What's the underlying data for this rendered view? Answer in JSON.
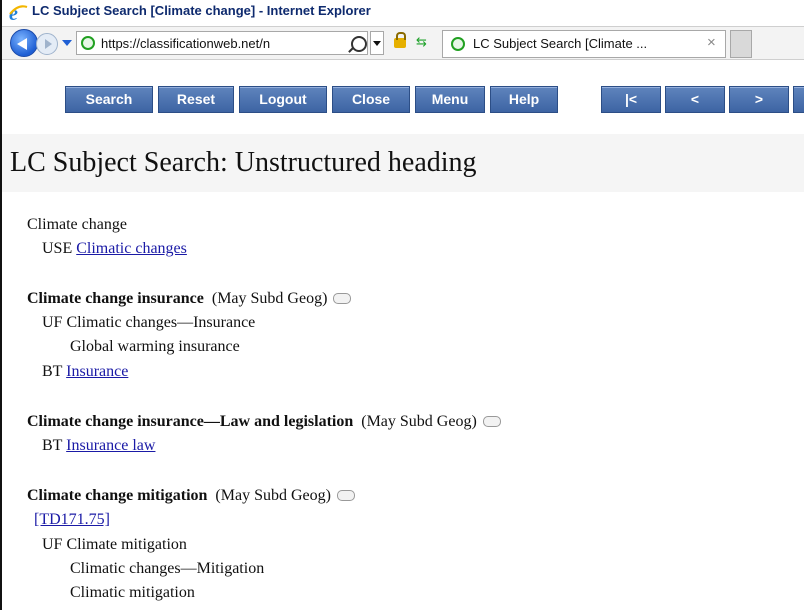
{
  "window": {
    "title": "LC Subject Search [Climate change] - Internet Explorer"
  },
  "address_bar": {
    "url": "https://classificationweb.net/n",
    "tab_title": "LC Subject Search [Climate ...",
    "tab_close": "×"
  },
  "toolbar": {
    "buttons": [
      "Search",
      "Reset",
      "Logout",
      "Close",
      "Menu",
      "Help",
      "|<",
      "<",
      ">"
    ]
  },
  "page": {
    "title": "LC Subject Search: Unstructured heading"
  },
  "entries": [
    {
      "heading": "Climate change",
      "use_label": "USE",
      "use_link": "Climatic changes"
    },
    {
      "heading": "Climate change insurance",
      "qualifier": "(May Subd Geog)",
      "uf_label": "UF",
      "uf": [
        "Climatic changes—Insurance",
        "Global warming insurance"
      ],
      "bt_label": "BT",
      "bt": "Insurance"
    },
    {
      "heading": "Climate change insurance—Law and legislation",
      "qualifier": "(May Subd Geog)",
      "bt_label": "BT",
      "bt": "Insurance law"
    },
    {
      "heading": "Climate change mitigation",
      "qualifier": "(May Subd Geog)",
      "class_number": "[TD171.75]",
      "uf_label": "UF",
      "uf": [
        "Climate mitigation",
        "Climatic changes—Mitigation",
        "Climatic mitigation"
      ]
    }
  ]
}
